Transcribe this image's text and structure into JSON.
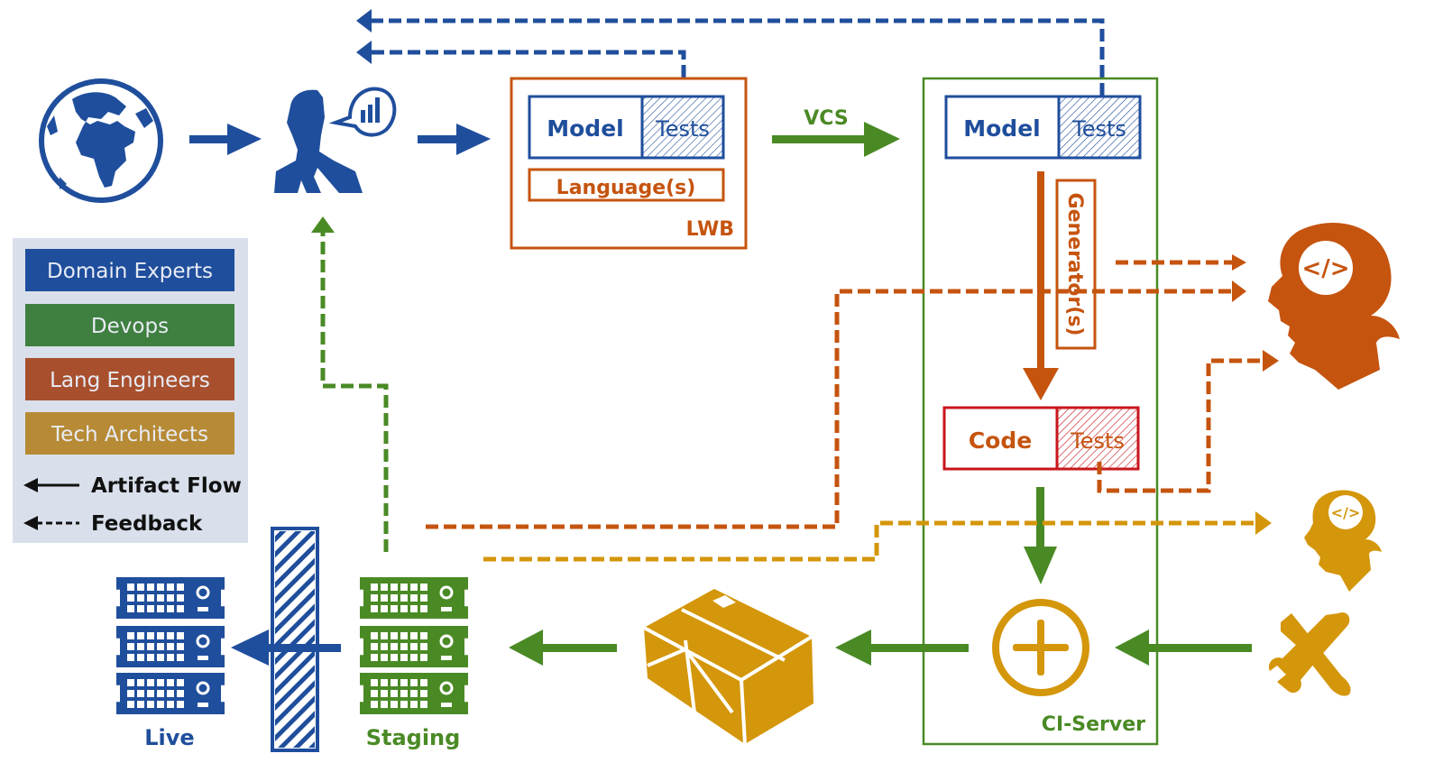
{
  "colors": {
    "blue": "#1f4e9c",
    "green": "#4a8a25",
    "orange": "#c5540f",
    "gold": "#d4960a",
    "red": "#c8161d",
    "legend_bg": "#d9e0ec",
    "legend_blue": "#1f4e9c",
    "legend_green": "#3f7f3f",
    "legend_orange": "#a8502e",
    "legend_gold": "#b78a35",
    "dark": "#111111"
  },
  "icons": {
    "world": "globe-icon",
    "domain_expert": "businessman-speech-chart-icon",
    "lang_engineer": "woman-head-code-icon",
    "tech_architect": "woman-head-code-icon",
    "tools": "wrench-screwdriver-icon",
    "merge": "circled-plus-icon",
    "package": "box-icon",
    "server": "server-rack-icon",
    "firewall": "hatched-barrier-icon"
  },
  "lwb": {
    "label": "LWB",
    "model": "Model",
    "tests": "Tests",
    "languages": "Language(s)"
  },
  "vcs": {
    "label": "VCS"
  },
  "ci_server": {
    "label": "CI-Server",
    "model": "Model",
    "tests": "Tests",
    "generators": "Generator(s)",
    "code": "Code",
    "code_tests": "Tests"
  },
  "environments": {
    "live": "Live",
    "staging": "Staging"
  },
  "legend": {
    "roles": [
      {
        "label": "Domain Experts",
        "color_key": "legend_blue"
      },
      {
        "label": "Devops",
        "color_key": "legend_green"
      },
      {
        "label": "Lang Engineers",
        "color_key": "legend_orange"
      },
      {
        "label": "Tech Architects",
        "color_key": "legend_gold"
      }
    ],
    "artifact_flow": "Artifact Flow",
    "feedback": "Feedback"
  }
}
